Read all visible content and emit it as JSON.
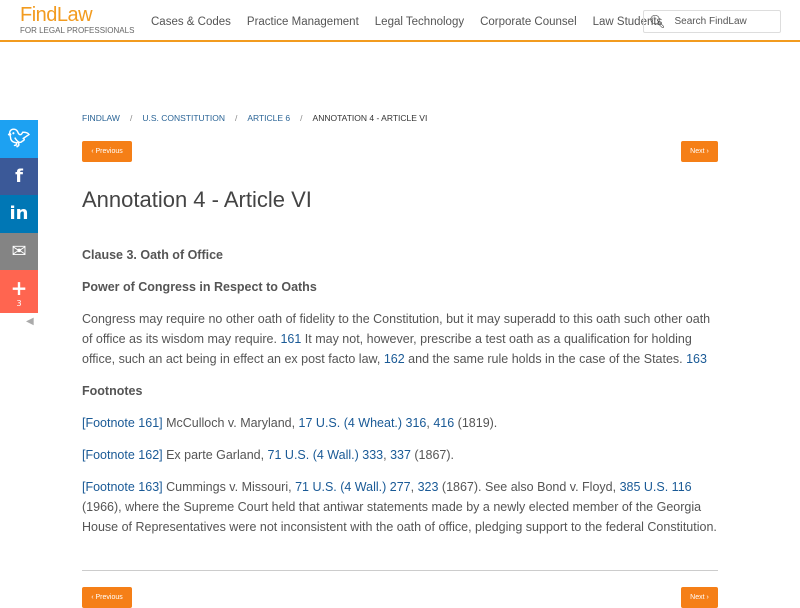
{
  "header": {
    "brand": "FindLaw",
    "tagline": "FOR LEGAL PROFESSIONALS",
    "nav": [
      "Cases & Codes",
      "Practice Management",
      "Legal Technology",
      "Corporate Counsel",
      "Law Students"
    ],
    "search_placeholder": "Search FindLaw"
  },
  "share": {
    "count": "3"
  },
  "breadcrumb": [
    "FINDLAW",
    "U.S. CONSTITUTION",
    "ARTICLE 6",
    "ANNOTATION 4 - ARTICLE VI"
  ],
  "pager": {
    "prev": "‹ Previous",
    "next": "Next ›"
  },
  "title": "Annotation 4 - Article VI",
  "clause": "Clause 3. Oath of Office",
  "subheading": "Power of Congress in Respect to Oaths",
  "body": [
    "Congress may require no other oath of fidelity to the Constitution, but it may superadd to this oath such other oath of office as its wisdom may require. ",
    "161",
    " It may not, however, prescribe a test oath as a qualification for holding office, such an act being in effect an ex post facto law, ",
    "162",
    " and the same rule holds in the case of the States. ",
    "163"
  ],
  "footnotes_heading": "Footnotes",
  "footnotes": [
    [
      "[Footnote 161]",
      " McCulloch v. Maryland, ",
      "17 U.S. (4 Wheat.) 316",
      ", ",
      "416",
      " (1819)."
    ],
    [
      "[Footnote 162]",
      " Ex parte Garland, ",
      "71 U.S. (4 Wall.) 333",
      ", ",
      "337",
      " (1867)."
    ],
    [
      "[Footnote 163]",
      " Cummings v. Missouri, ",
      "71 U.S. (4 Wall.) 277",
      ", ",
      "323",
      " (1867). See also Bond v. Floyd, ",
      "385 U.S. 116",
      " (1966), where the Supreme Court held that antiwar statements made by a newly elected member of the Georgia House of Representatives were not inconsistent with the oath of office, pledging support to the federal Constitution."
    ]
  ]
}
